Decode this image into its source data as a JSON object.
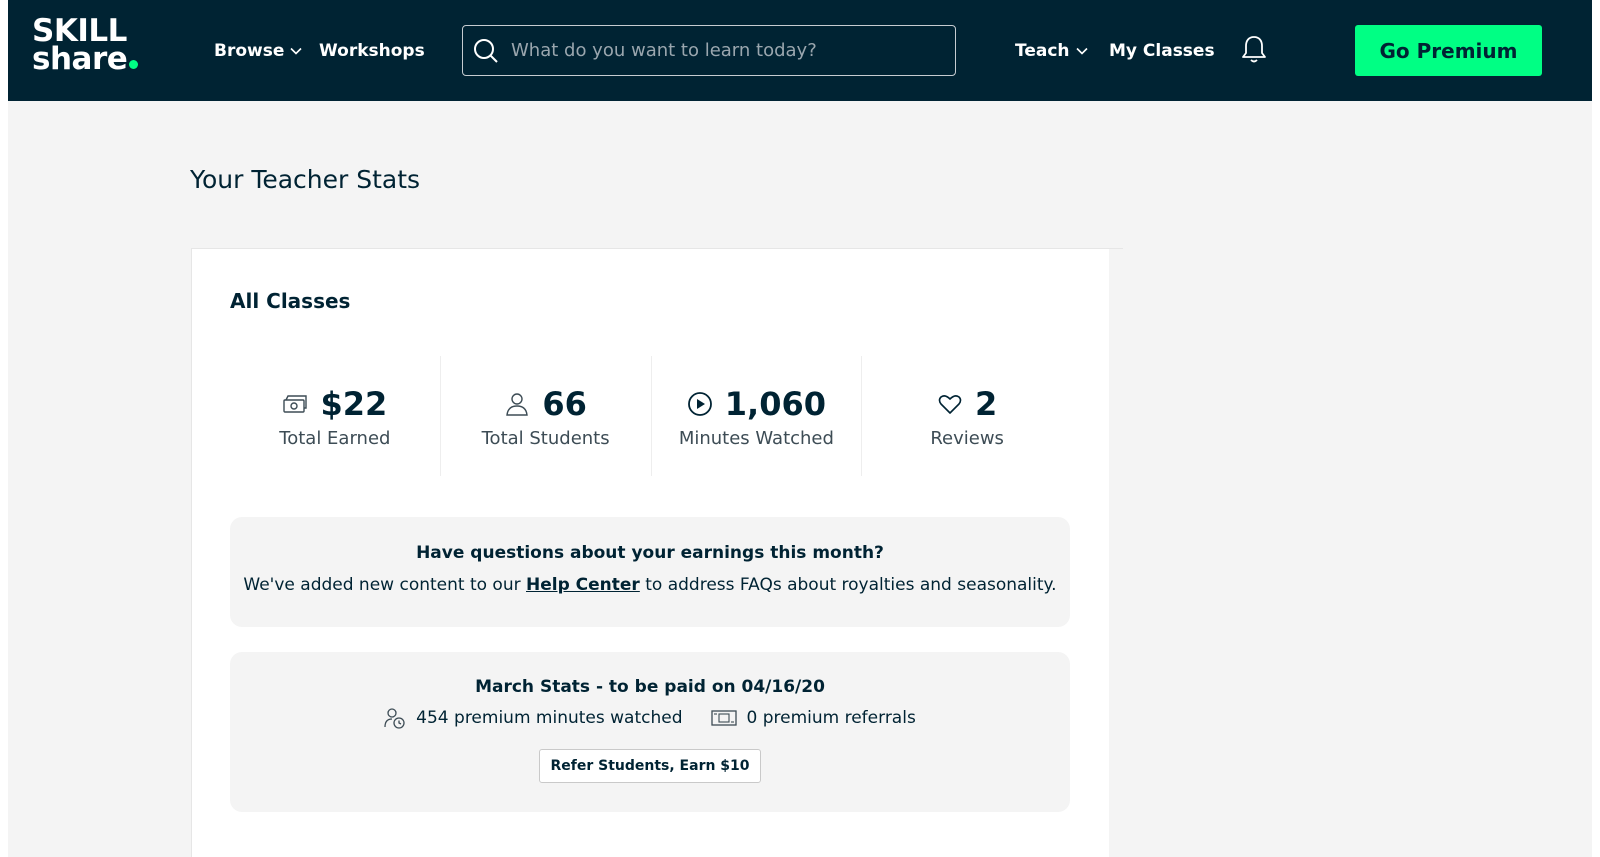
{
  "header": {
    "logo_line1": "SKILL",
    "logo_line2": "share",
    "nav": {
      "browse": "Browse",
      "workshops": "Workshops",
      "teach": "Teach",
      "my_classes": "My Classes"
    },
    "search_placeholder": "What do you want to learn today?",
    "premium_label": "Go Premium"
  },
  "page": {
    "title": "Your Teacher Stats"
  },
  "card": {
    "title": "All Classes",
    "stats": [
      {
        "value": "$22",
        "label": "Total Earned",
        "icon": "money-icon"
      },
      {
        "value": "66",
        "label": "Total Students",
        "icon": "user-icon"
      },
      {
        "value": "1,060",
        "label": "Minutes Watched",
        "icon": "play-icon"
      },
      {
        "value": "2",
        "label": "Reviews",
        "icon": "heart-icon"
      }
    ],
    "info": {
      "title": "Have questions about your earnings this month?",
      "text_before": "We've added new content to our ",
      "link": "Help Center",
      "text_after": " to address FAQs about royalties and seasonality."
    },
    "march": {
      "title": "March Stats - to be paid on 04/16/20",
      "premium_minutes": "454 premium minutes watched",
      "premium_referrals": "0 premium referrals",
      "refer_button": "Refer Students, Earn $10"
    }
  },
  "colors": {
    "nav_bg": "#002333",
    "accent": "#00ff84",
    "page_bg": "#f4f4f4"
  }
}
